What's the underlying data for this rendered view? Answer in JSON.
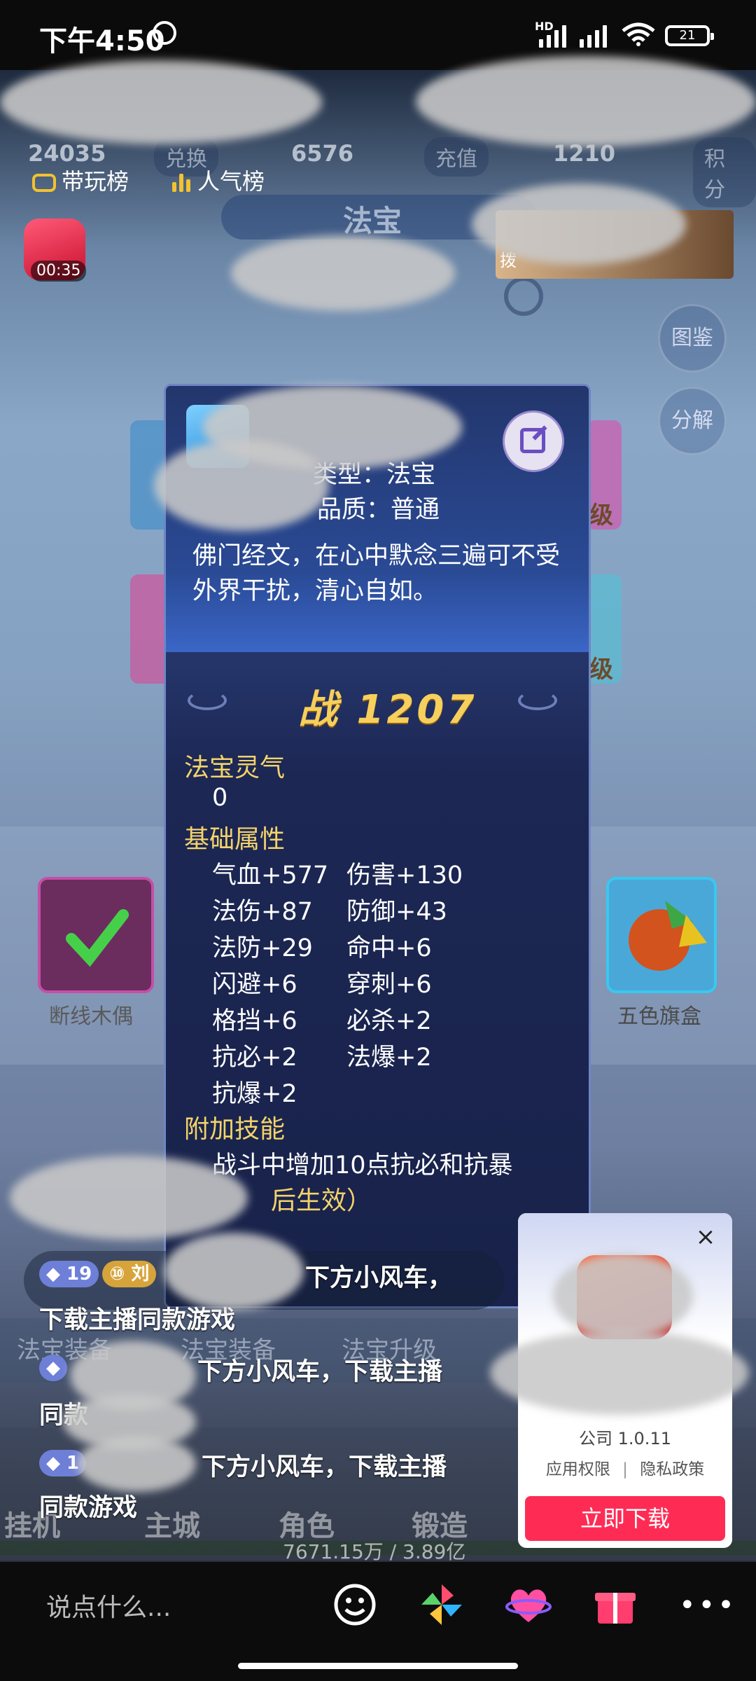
{
  "status_bar": {
    "time": "下午4:50",
    "network": "HD",
    "battery": "21"
  },
  "game": {
    "hud": {
      "coins": "24035",
      "exchange_label": "兑换",
      "gems": "6576",
      "recharge_label": "充值",
      "jade": "1210",
      "activity_label": "积分"
    },
    "title": "法宝",
    "side_buttons": [
      "图鉴",
      "分解"
    ],
    "items": {
      "left_name": "断线木偶",
      "right_name": "五色旗盒"
    },
    "level_tags": [
      "级",
      "级"
    ],
    "bottom_tabs": [
      "法宝装备",
      "法宝装备",
      "法宝升级"
    ],
    "nav": [
      "挂机",
      "主城",
      "角色",
      "锻造"
    ],
    "exp_text": "7671.15万 / 3.89亿"
  },
  "live": {
    "rank_play": "带玩榜",
    "rank_popular": "人气榜",
    "redpack_timer": "00:35",
    "panel_mark": "拨"
  },
  "tooltip": {
    "type_line": "类型：法宝",
    "quality_line": "品质：普通",
    "description": [
      "佛门经文，在心中默念三遍可不受",
      "外界干扰，清心自如。"
    ],
    "power_label": "战",
    "power_value": "1207",
    "spirit_heading": "法宝灵气",
    "spirit_value": "0",
    "base_heading": "基础属性",
    "attributes": [
      [
        "气血+577",
        "伤害+130"
      ],
      [
        "法伤+87",
        "防御+43"
      ],
      [
        "法防+29",
        "命中+6"
      ],
      [
        "闪避+6",
        "穿刺+6"
      ],
      [
        "格挡+6",
        "必杀+2"
      ],
      [
        "抗必+2",
        "法爆+2"
      ],
      [
        "抗爆+2",
        ""
      ]
    ],
    "skill_heading": "附加技能",
    "skill_text": "战斗中增加10点抗必和抗暴",
    "skill_note": "后生效）"
  },
  "chat": [
    {
      "level": "19",
      "fan_level": "10",
      "user": "刘",
      "message_line1": "下方小风车，",
      "message_line2": "下载主播同款游戏"
    },
    {
      "level": "",
      "user": "",
      "message_line1": "下方小风车，下载主播",
      "message_line2": "同款"
    },
    {
      "level": "1",
      "user": "",
      "message_line1": "下方小风车，下载主播",
      "message_line2": "同款游戏"
    }
  ],
  "ad_card": {
    "version": "公司 1.0.11",
    "permission": "应用权限",
    "separator": "|",
    "privacy": "隐私政策",
    "download": "立即下载",
    "close": "×"
  },
  "bottom_bar": {
    "placeholder": "说点什么...",
    "icons": [
      "emoji-icon",
      "pinwheel-icon",
      "heart-icon",
      "gift-icon",
      "more-icon"
    ]
  }
}
